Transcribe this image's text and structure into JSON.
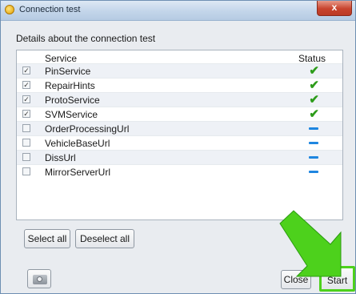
{
  "window": {
    "title": "Connection test",
    "close_glyph": "x"
  },
  "heading": "Details about the connection test",
  "table": {
    "columns": {
      "service": "Service",
      "status": "Status"
    },
    "rows": [
      {
        "name": "PinService",
        "checked": true,
        "status": "ok"
      },
      {
        "name": "RepairHints",
        "checked": true,
        "status": "ok"
      },
      {
        "name": "ProtoService",
        "checked": true,
        "status": "ok"
      },
      {
        "name": "SVMService",
        "checked": true,
        "status": "ok"
      },
      {
        "name": "OrderProcessingUrl",
        "checked": false,
        "status": "none"
      },
      {
        "name": "VehicleBaseUrl",
        "checked": false,
        "status": "none"
      },
      {
        "name": "DissUrl",
        "checked": false,
        "status": "none"
      },
      {
        "name": "MirrorServerUrl",
        "checked": false,
        "status": "none"
      }
    ]
  },
  "buttons": {
    "select_all": "Select all",
    "deselect_all": "Deselect all",
    "close": "Close",
    "start": "Start"
  },
  "icons": {
    "app": "app-icon",
    "camera": "camera-icon",
    "status_ok": "checkmark-icon",
    "status_none": "dash-icon",
    "annotation": "green-arrow-icon"
  },
  "colors": {
    "ok": "#2d9c1a",
    "none": "#1f86e0",
    "arrow": "#4dd11c",
    "highlight": "#4dd11c"
  }
}
